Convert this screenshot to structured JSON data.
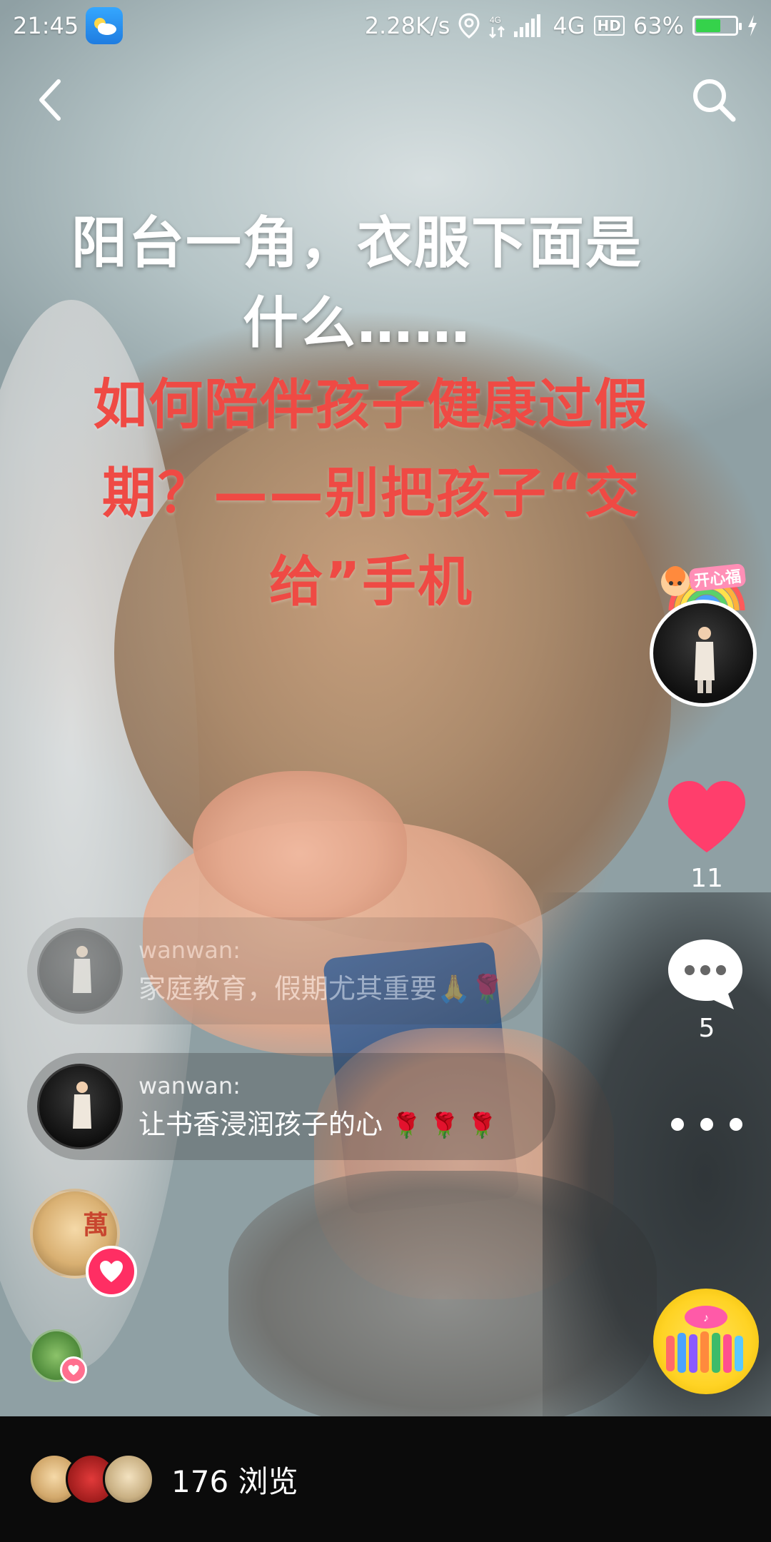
{
  "status_bar": {
    "time": "21:45",
    "network_speed": "2.28K/s",
    "network_type": "4G",
    "hd_label": "HD",
    "battery_percent": "63%",
    "battery_level": 0.63
  },
  "overlay": {
    "title_line1": "阳台一角，衣服下面是",
    "title_line2": "什么……",
    "red_line1": "如何陪伴孩子健康过假",
    "red_line2": "期？——别把孩子“交",
    "red_line3": "给”手机"
  },
  "author": {
    "badge_text": "开心福"
  },
  "actions": {
    "like_count": "11",
    "comment_count": "5"
  },
  "comments": [
    {
      "name": "wanwan:",
      "text": "家庭教育，假期尤其重要🙏🌹"
    },
    {
      "name": "wanwan:",
      "text": "让书香浸润孩子的心",
      "flowers": "🌹 🌹 🌹"
    }
  ],
  "viewers": {
    "big_avatar_char": "萬"
  },
  "bottom_bar": {
    "views": "176 浏览"
  },
  "colors": {
    "like": "#ff3e6c",
    "red_text": "#ef4a44",
    "battery": "#35d24b"
  }
}
